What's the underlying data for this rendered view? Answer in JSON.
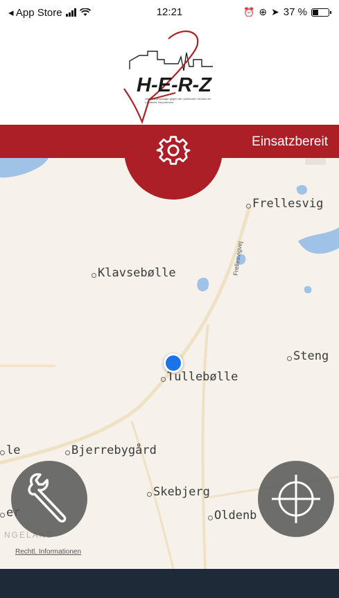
{
  "status_bar": {
    "back_label": "◂ App Store",
    "time": "12:21",
    "battery_text": "37 %",
    "battery_level": 0.37
  },
  "header": {
    "logo_text": "H-E-R-Z",
    "logo_caption": "Herzdruckmassage gegen den plötzlichen Herztod im Landkreis Vorpommern"
  },
  "status_banner": {
    "label": "Einsatzbereit",
    "color": "#ad1f27",
    "settings_icon": "gear-icon"
  },
  "map": {
    "places": {
      "frellesvig": "Frellesvig",
      "klavsebolle": "Klavsebølle",
      "steng": "Steng",
      "tullebolle": "Tullebølle",
      "bjerrebygard": "Bjerrebygård",
      "skebjerg": "Skebjerg",
      "oldenb": "Oldenb",
      "le": "le",
      "er": "er"
    },
    "road_label": "Frellesvigvej",
    "faint_text": "NGELAND",
    "legal_link": "Rechtl. Informationen"
  },
  "buttons": {
    "tools_icon": "wrench-icon",
    "locate_icon": "crosshair-icon"
  }
}
